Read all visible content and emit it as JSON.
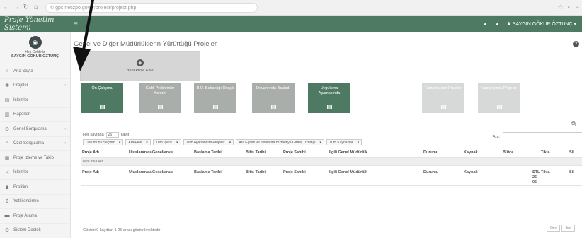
{
  "browser": {
    "url": "© gps.netizpo.gov.tr/project/project.php",
    "right_icons": [
      "☆",
      "◐",
      "≡"
    ]
  },
  "header": {
    "brand": "Proje Yönetim Sistemi",
    "menu_icon": "≡",
    "bell": "▲",
    "user_label": "SAYGIN GÖKUR ÖZTUNÇ"
  },
  "sidebar": {
    "welcome": "Hoş Geldiniz",
    "username": "SAYGIN GÖKUR ÖZTUNÇ",
    "items": [
      {
        "icon": "home-icon",
        "glyph": "⌂",
        "label": "Ana Sayfa",
        "has_children": false
      },
      {
        "icon": "puzzle-icon",
        "glyph": "✱",
        "label": "Projeler",
        "has_children": true
      },
      {
        "icon": "file-icon",
        "glyph": "▤",
        "label": "İşlemler",
        "has_children": false
      },
      {
        "icon": "report-icon",
        "glyph": "▥",
        "label": "Raporlar",
        "has_children": false
      },
      {
        "icon": "settings-icon",
        "glyph": "⚙",
        "label": "Genel Sorgulama",
        "has_children": true
      },
      {
        "icon": "search-icon",
        "glyph": "⌕",
        "label": "Özel Sorgulama",
        "has_children": true
      },
      {
        "icon": "tracking-icon",
        "glyph": "▦",
        "label": "Proje İzleme ve Takip",
        "has_children": false
      },
      {
        "icon": "share-icon",
        "glyph": "≺",
        "label": "İşlemler",
        "has_children": false
      },
      {
        "icon": "user-icon",
        "glyph": "♟",
        "label": "Profilim",
        "has_children": false
      },
      {
        "icon": "dollar-icon",
        "glyph": "$",
        "label": "Yetkilendirme",
        "has_children": false
      },
      {
        "icon": "book-icon",
        "glyph": "▬",
        "label": "Proje Arama",
        "has_children": false
      },
      {
        "icon": "gear-icon",
        "glyph": "⚙",
        "label": "Sistem Destek",
        "has_children": false
      }
    ]
  },
  "main": {
    "title": "Genel ve Diğer Müdürlüklerin Yürüttüğü Projeler",
    "new_project_label": "Yeni Proje Ekle",
    "tiles": [
      {
        "label": "Ön Çalışma",
        "color": "#4e7a64"
      },
      {
        "label": "Ciddi Problemler Kontrol",
        "color": "#a9aeab"
      },
      {
        "label": "B.Ü. Bakanlığı Onaylı",
        "color": "#a9aeab"
      },
      {
        "label": "Devamında Başladı",
        "color": "#a9aeab"
      },
      {
        "label": "Uygulama Aşamasında",
        "color": "#4e7a64"
      },
      {
        "label": "Tamamlanan Projeler",
        "color": "#d7d9d8"
      },
      {
        "label": "Vazgeçilmiş Projeler",
        "color": "#d7d9d8"
      }
    ],
    "show_label": "Her sayfada",
    "page_size": "25",
    "records_label": "kayıt",
    "search_label": "Ara:",
    "filters": [
      "Durumunu Seçiniz",
      "Ara/Ekle",
      "Tüm İçerik",
      "Tüm Ayarlandırıl Projeler",
      "Ara Eğitim ve Sonlarda Hizmetiye Girmiş Uzdingi",
      "Tüm Kaynaklar"
    ],
    "columns": [
      "Proje Adı",
      "Uluslararası/Genel/arası",
      "Başlama Tarihi",
      "Bitiş Tarihi",
      "Proje Sahibi",
      "İlgili Genel Müdürlük",
      "Durumu",
      "Kaynak",
      "Bütçe",
      "Tıkla",
      "Sil"
    ],
    "group_row": "Yeni Yıla Ait",
    "footer_columns": [
      "Proje Adı",
      "Uluslararası/Genel/arası",
      "Başlama Tarihi",
      "Bitiş Tarihi",
      "Proje Sahibi",
      "İlgili Genel Müdürlük",
      "Durumu",
      "Kaynak",
      "",
      "Tıkla",
      "Sil"
    ],
    "footer_budget_lines": [
      "STL",
      "26",
      "05"
    ],
    "info": "Gösteri 0 kayıttan 1 25 arası gösterilmektedir",
    "pager": {
      "prev": "Geri",
      "next": "İleri"
    }
  },
  "colors": {
    "brand_green": "#4e7a64",
    "tile_grey": "#a9aeab",
    "tile_light": "#d7d9d8",
    "arrow": "#111111"
  }
}
